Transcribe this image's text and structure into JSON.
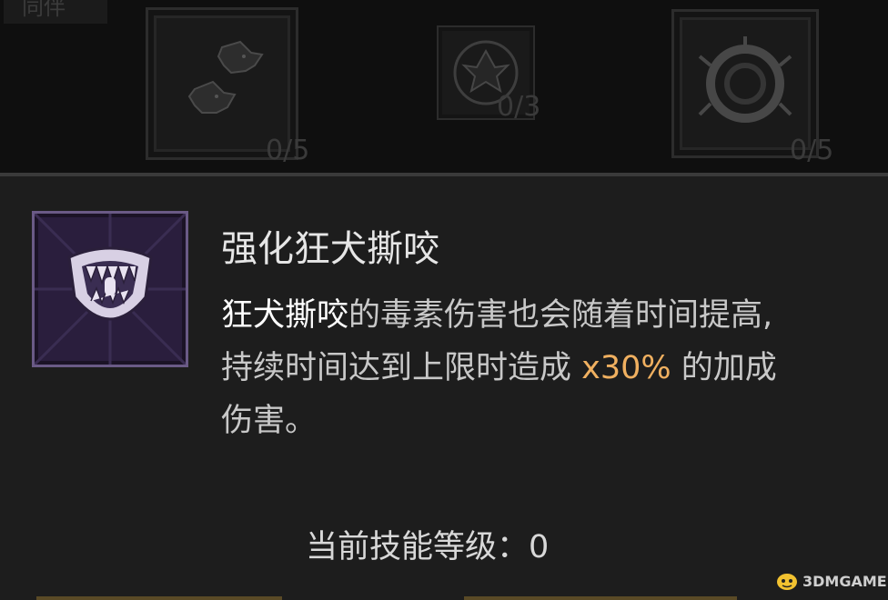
{
  "top_tab": {
    "label": "同伴"
  },
  "skill_slots": [
    {
      "name": "wolves",
      "count": "0/5"
    },
    {
      "name": "sigil",
      "count": "0/3"
    },
    {
      "name": "thorn-ring",
      "count": "0/5"
    }
  ],
  "tooltip": {
    "title": "强化狂犬撕咬",
    "desc_skill": "狂犬撕咬",
    "desc_part1": "的毒素伤害也会随着时间提高,",
    "desc_part2": "持续时间达到上限时造成 ",
    "desc_value": "x30%",
    "desc_part3": " 的加成",
    "desc_part4": "伤害。",
    "level_label": "当前技能等级：",
    "level_value": "0"
  },
  "watermark": {
    "text": "3DMGAME"
  },
  "colors": {
    "highlight": "#f0b060",
    "panel": "#1d1d1d",
    "icon_purple": "#6a5a86"
  }
}
